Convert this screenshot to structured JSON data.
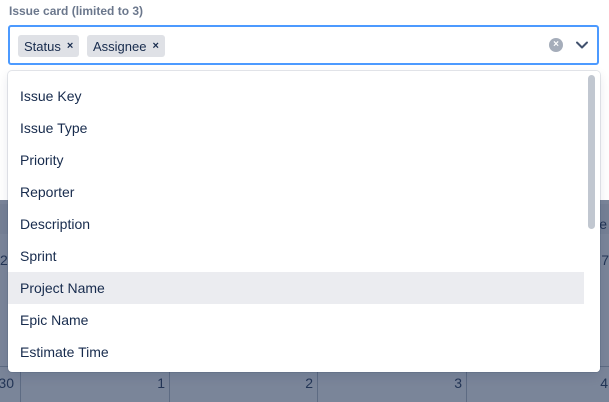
{
  "field": {
    "label": "Issue card (limited to 3)",
    "selected_tags": [
      {
        "label": "Status",
        "remove": "×"
      },
      {
        "label": "Assignee",
        "remove": "×"
      }
    ],
    "clear_symbol": "×"
  },
  "dropdown": {
    "options": [
      {
        "label": "Issue Key"
      },
      {
        "label": "Issue Type"
      },
      {
        "label": "Priority"
      },
      {
        "label": "Reporter"
      },
      {
        "label": "Description"
      },
      {
        "label": "Sprint"
      },
      {
        "label": "Project Name"
      },
      {
        "label": "Epic Name"
      },
      {
        "label": "Estimate Time"
      }
    ],
    "highlighted": "Project Name"
  },
  "background": {
    "toolbar_fragment": "e",
    "week_left_fragment": "2",
    "week_right_fragment": "7",
    "row_day_numbers": [
      "30",
      "1",
      "2",
      "3",
      "4"
    ]
  },
  "colors": {
    "focus_border": "#4c9aff",
    "tag_bg": "#dfe1e6",
    "highlight_bg": "#ebecf0",
    "overlay": "rgba(9,30,66,0.54)"
  }
}
